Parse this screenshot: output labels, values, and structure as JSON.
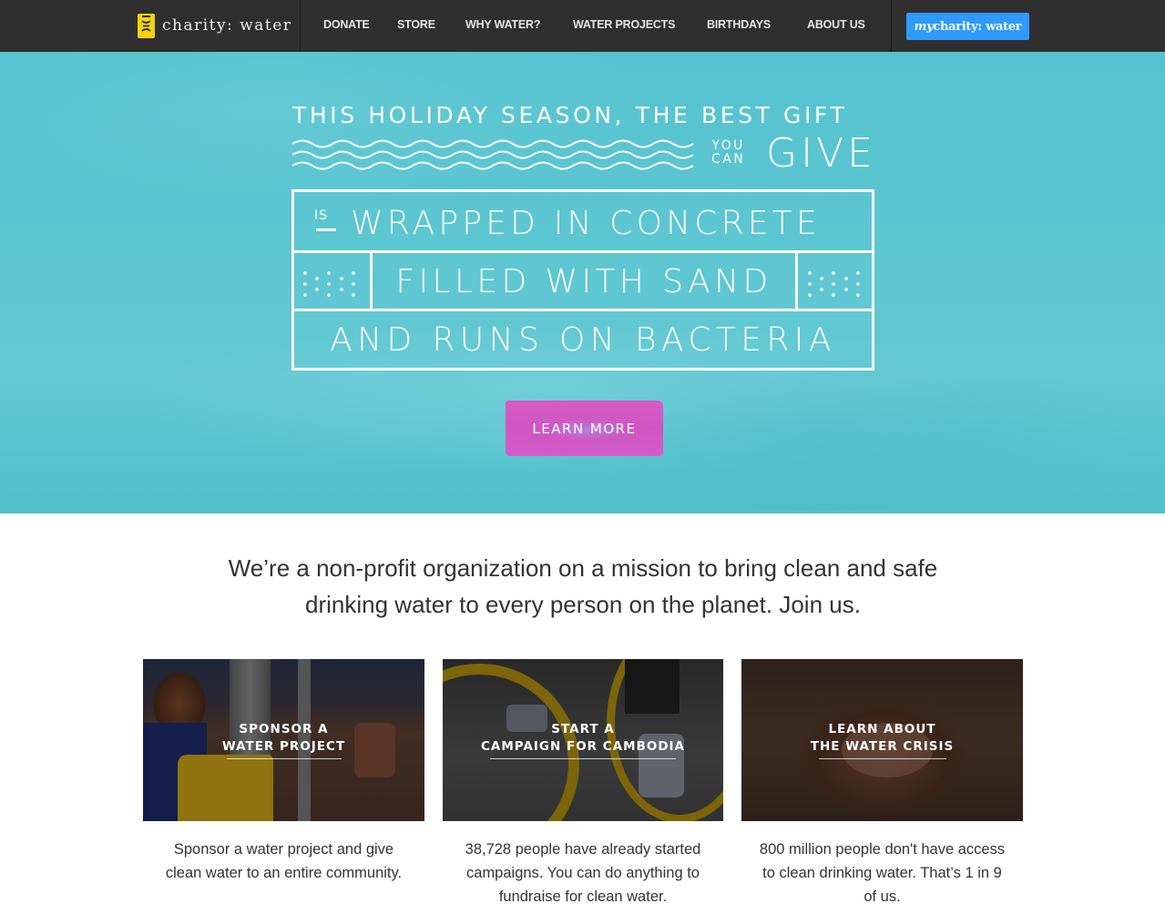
{
  "nav": {
    "logo_text": "charity: water",
    "links": [
      "DONATE",
      "STORE",
      "WHY WATER?",
      "WATER PROJECTS",
      "BIRTHDAYS",
      "ABOUT US"
    ],
    "cta_prefix": "my",
    "cta_rest": "charity: water"
  },
  "hero": {
    "line1": "THIS HOLIDAY SEASON, THE BEST GIFT",
    "you": "YOU",
    "can": "CAN",
    "give": "GIVE",
    "is": "IS",
    "row1": "WRAPPED IN CONCRETE",
    "row2": "FILLED WITH SAND",
    "row3": "AND RUNS ON BACTERIA",
    "button_label": "LEARN MORE"
  },
  "mission": {
    "text_line1": "We’re a non-profit organization on a mission to bring clean and safe",
    "text_line2": "drinking water to every person on the planet. Join us."
  },
  "cards": [
    {
      "title_line1": "SPONSOR A",
      "title_line2": "WATER PROJECT",
      "description": "Sponsor a water project and give clean water to an entire community."
    },
    {
      "title_line1": "START A",
      "title_line2": "CAMPAIGN FOR CAMBODIA",
      "description": "38,728 people have already started campaigns. You can do anything to fundraise for clean water."
    },
    {
      "title_line1": "LEARN ABOUT",
      "title_line2": "THE WATER CRISIS",
      "description": "800 million people don't have access to clean drinking water. That’s 1 in 9 of us."
    }
  ],
  "colors": {
    "nav_bg": "#2f2f2f",
    "logo_yellow": "#f5d20f",
    "cta_blue": "#2f9aff",
    "hero_teal": "#5cc6d1",
    "learn_more_pink": "#d158c5"
  }
}
